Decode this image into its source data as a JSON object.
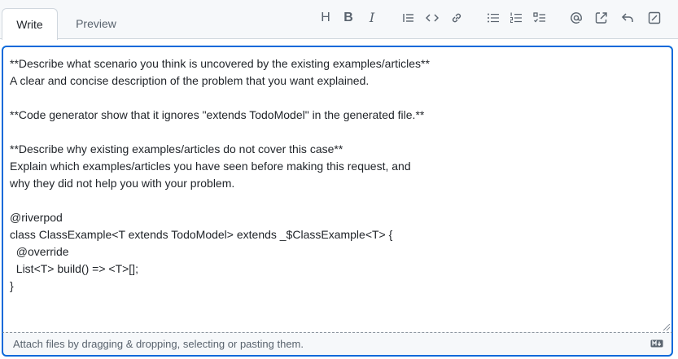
{
  "tabs": {
    "write": "Write",
    "preview": "Preview"
  },
  "toolbar": {
    "heading": "H",
    "bold": "B",
    "italic": "I"
  },
  "editor": {
    "value": "**Describe what scenario you think is uncovered by the existing examples/articles**\nA clear and concise description of the problem that you want explained.\n\n**Code generator show that it ignores \"extends TodoModel\" in the generated file.**\n\n**Describe why existing examples/articles do not cover this case**\nExplain which examples/articles you have seen before making this request, and\nwhy they did not help you with your problem.\n\n@riverpod\nclass ClassExample<T extends TodoModel> extends _$ClassExample<T> {\n  @override\n  List<T> build() => <T>[];\n}"
  },
  "footer": {
    "attach_text": "Attach files by dragging & dropping, selecting or pasting them."
  },
  "colors": {
    "accent": "#0969da",
    "muted": "#59636e",
    "border": "#d0d7de",
    "header_bg": "#f6f8fa"
  }
}
